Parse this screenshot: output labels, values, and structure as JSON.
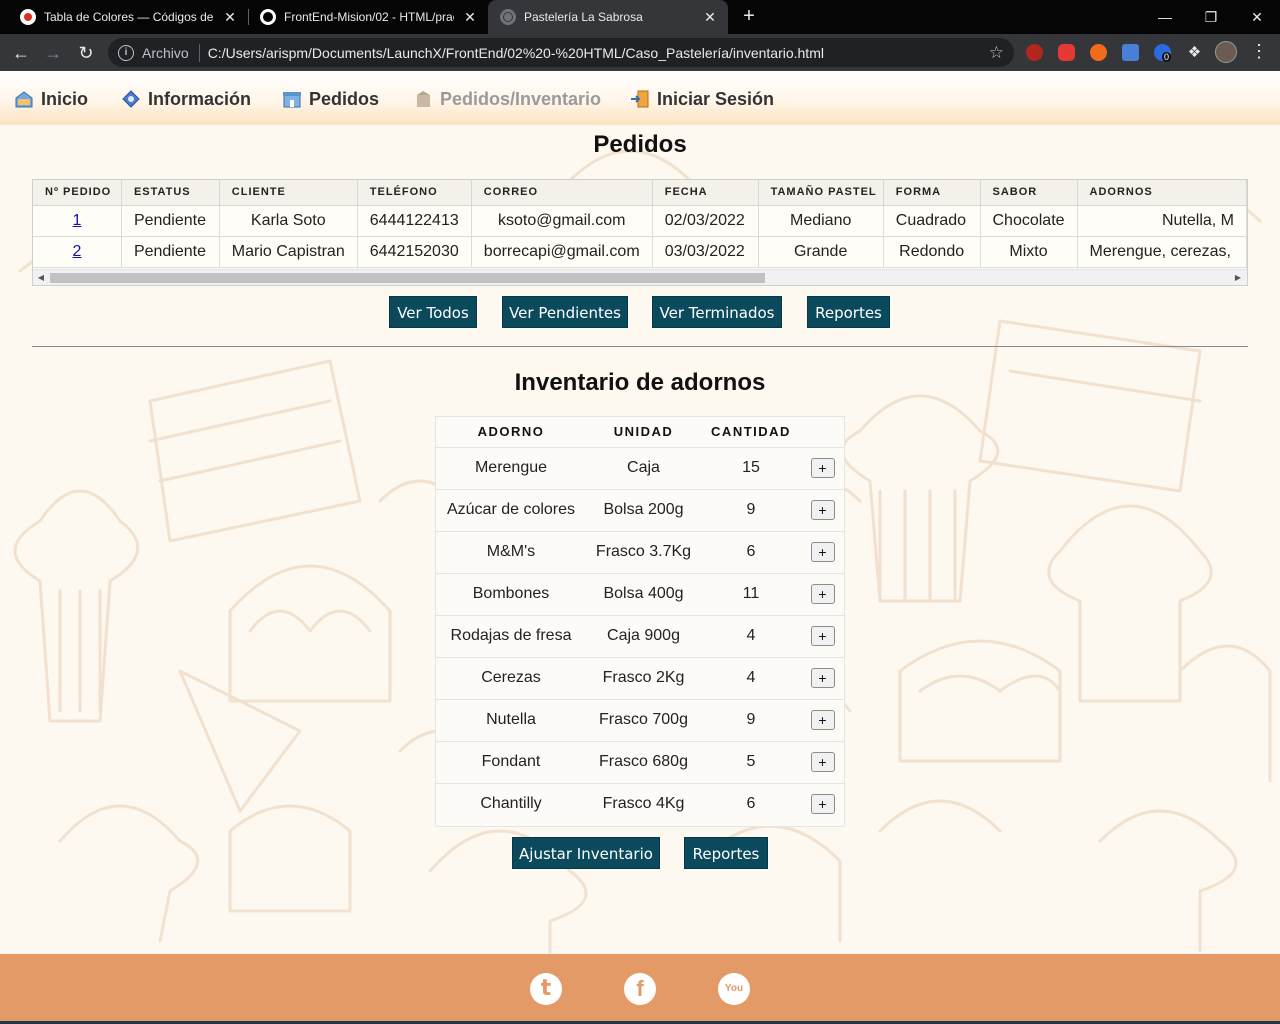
{
  "browser": {
    "tabs": [
      {
        "title": "Tabla de Colores — Códigos de C",
        "active": false
      },
      {
        "title": "FrontEnd-Mision/02 - HTML/prac",
        "active": false
      },
      {
        "title": "Pastelería La Sabrosa",
        "active": true
      }
    ],
    "omnibox": {
      "scheme_label": "Archivo",
      "url": "C:/Users/arispm/Documents/LaunchX/FrontEnd/02%20-%20HTML/Caso_Pastelería/inventario.html"
    },
    "extension_badge": "0"
  },
  "nav": {
    "items": [
      {
        "label": "Inicio"
      },
      {
        "label": "Información"
      },
      {
        "label": "Pedidos"
      },
      {
        "label": "Pedidos/Inventario"
      },
      {
        "label": "Iniciar Sesión"
      }
    ]
  },
  "orders": {
    "title": "Pedidos",
    "columns": [
      "Nº PEDIDO",
      "ESTATUS",
      "CLIENTE",
      "TELÉFONO",
      "CORREO",
      "FECHA",
      "TAMAÑO PASTEL",
      "FORMA",
      "SABOR",
      "ADORNOS"
    ],
    "rows": [
      [
        "1",
        "Pendiente",
        "Karla Soto",
        "6444122413",
        "ksoto@gmail.com",
        "02/03/2022",
        "Mediano",
        "Cuadrado",
        "Chocolate",
        "Nutella, M"
      ],
      [
        "2",
        "Pendiente",
        "Mario Capistran",
        "6442152030",
        "borrecapi@gmail.com",
        "03/03/2022",
        "Grande",
        "Redondo",
        "Mixto",
        "Merengue, cerezas,"
      ]
    ],
    "buttons": {
      "all": "Ver Todos",
      "pending": "Ver Pendientes",
      "done": "Ver Terminados",
      "reports": "Reportes"
    }
  },
  "inventory": {
    "title": "Inventario de adornos",
    "columns": [
      "ADORNO",
      "UNIDAD",
      "CANTIDAD"
    ],
    "add_label": "+",
    "rows": [
      [
        "Merengue",
        "Caja",
        "15"
      ],
      [
        "Azúcar de colores",
        "Bolsa 200g",
        "9"
      ],
      [
        "M&M's",
        "Frasco 3.7Kg",
        "6"
      ],
      [
        "Bombones",
        "Bolsa 400g",
        "11"
      ],
      [
        "Rodajas de fresa",
        "Caja 900g",
        "4"
      ],
      [
        "Cerezas",
        "Frasco 2Kg",
        "4"
      ],
      [
        "Nutella",
        "Frasco 700g",
        "9"
      ],
      [
        "Fondant",
        "Frasco 680g",
        "5"
      ],
      [
        "Chantilly",
        "Frasco 4Kg",
        "6"
      ]
    ],
    "buttons": {
      "adjust": "Ajustar Inventario",
      "reports": "Reportes"
    }
  },
  "footer": {
    "social": [
      {
        "name": "twitter-icon",
        "glyph": "t"
      },
      {
        "name": "facebook-icon",
        "glyph": "f"
      },
      {
        "name": "youtube-icon",
        "glyph": "You"
      }
    ]
  },
  "colors": {
    "button_bg": "#0b4a5c",
    "footer_bg": "#e39a66",
    "page_bg": "#fdf8f0",
    "chrome_tabbar": "#050505",
    "chrome_toolbar": "#35363a"
  }
}
